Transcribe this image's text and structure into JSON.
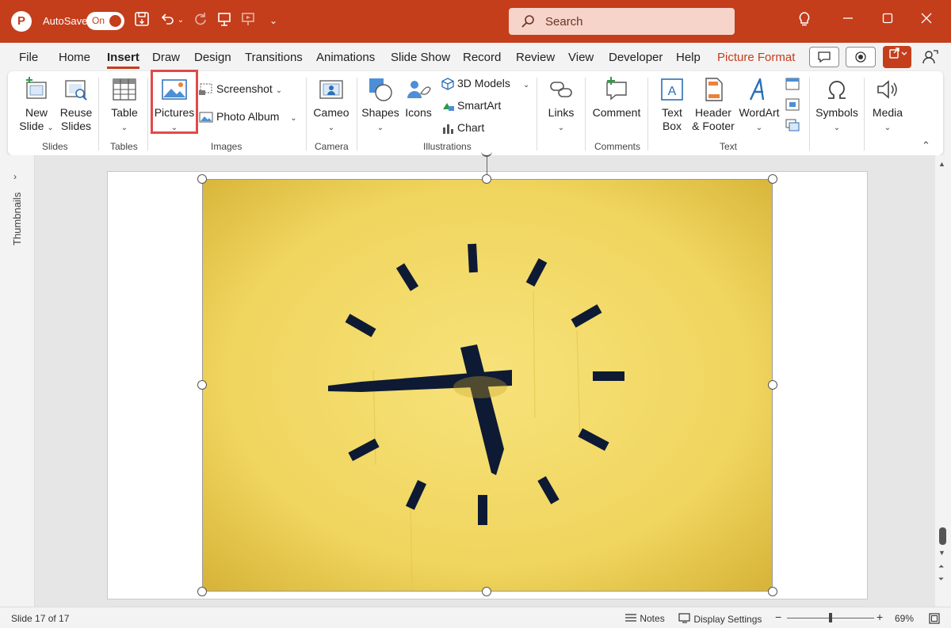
{
  "titlebar": {
    "app_icon": "powerpoint-logo",
    "autosave_label": "AutoSave",
    "autosave_state": "On",
    "search_placeholder": "Search",
    "bg_color": "#c43e1c"
  },
  "menu": {
    "tabs": [
      "File",
      "Home",
      "Insert",
      "Draw",
      "Design",
      "Transitions",
      "Animations",
      "Slide Show",
      "Record",
      "Review",
      "View",
      "Developer",
      "Help"
    ],
    "active_tab": "Insert",
    "context_tab": "Picture Format"
  },
  "ribbon": {
    "slides": {
      "label": "Slides",
      "new_slide": "New\nSlide",
      "reuse_slides": "Reuse\nSlides"
    },
    "tables": {
      "label": "Tables",
      "table": "Table"
    },
    "images": {
      "label": "Images",
      "pictures": "Pictures",
      "screenshot": "Screenshot",
      "photo_album": "Photo Album"
    },
    "camera": {
      "label": "Camera",
      "cameo": "Cameo"
    },
    "illustrations": {
      "label": "Illustrations",
      "shapes": "Shapes",
      "icons": "Icons",
      "models": "3D Models",
      "smartart": "SmartArt",
      "chart": "Chart"
    },
    "links": {
      "label": "",
      "links": "Links"
    },
    "comments": {
      "label": "Comments",
      "comment": "Comment"
    },
    "text": {
      "label": "Text",
      "text_box": "Text\nBox",
      "header_footer": "Header\n& Footer",
      "wordart": "WordArt"
    },
    "symbols": {
      "symbols": "Symbols"
    },
    "media": {
      "media": "Media"
    }
  },
  "left_pane": {
    "label": "Thumbnails"
  },
  "slide": {
    "image_subject": "yellow-wall-clock"
  },
  "status": {
    "slide_position": "Slide 17 of 17",
    "notes": "Notes",
    "display_settings": "Display Settings",
    "zoom": "69%",
    "zoom_fraction": 0.5
  },
  "colors": {
    "accent": "#c43e1c",
    "highlight": "#e14a4a",
    "picture_bg": "#f2dc6e",
    "clock_marks": "#0e1a34"
  }
}
